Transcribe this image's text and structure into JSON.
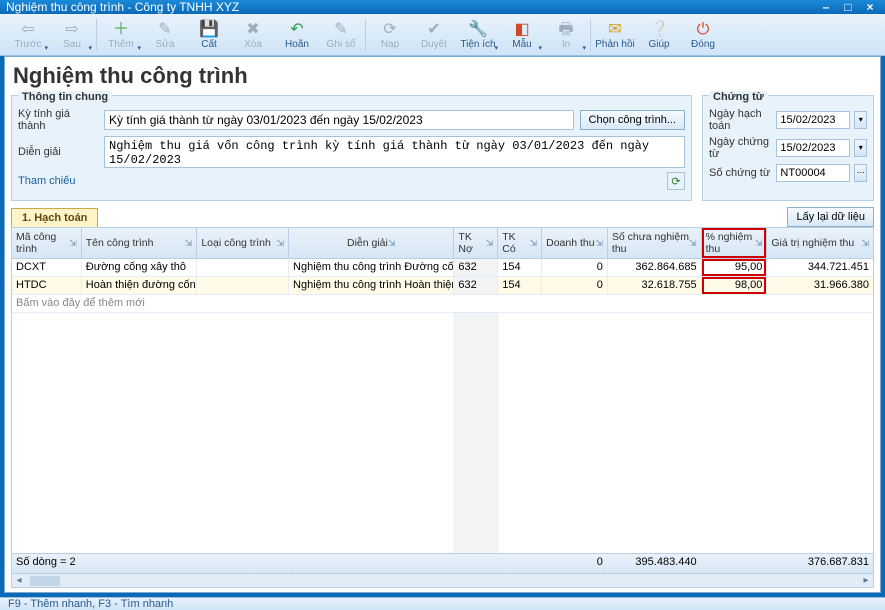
{
  "window": {
    "title": "Nghiệm thu công trình - Công ty TNHH XYZ"
  },
  "toolbar": {
    "truoc": "Trước",
    "sau": "Sau",
    "them": "Thêm",
    "sua": "Sửa",
    "cat": "Cất",
    "xoa": "Xóa",
    "hoan": "Hoãn",
    "ghiso": "Ghi sổ",
    "nap": "Nạp",
    "duyet": "Duyệt",
    "tienich": "Tiện ích",
    "mau": "Mẫu",
    "in": "In",
    "phanhoi": "Phản hồi",
    "giup": "Giúp",
    "dong": "Đóng"
  },
  "page": {
    "title": "Nghiệm thu công trình"
  },
  "general": {
    "legend": "Thông tin chung",
    "ky_label": "Kỳ tính giá thành",
    "ky_value": "Kỳ tính giá thành từ ngày 03/01/2023 đến ngày 15/02/2023",
    "choncongtrinh": "Chọn công trình...",
    "diengiai_label": "Diễn giải",
    "diengiai_value": "Nghiệm thu giá vốn công trình kỳ tính giá thành từ ngày 03/01/2023 đến ngày 15/02/2023",
    "thamchieu": "Tham chiếu"
  },
  "voucher": {
    "legend": "Chứng từ",
    "ngayhachtoan_label": "Ngày hạch toán",
    "ngayhachtoan": "15/02/2023",
    "ngaychungtu_label": "Ngày chứng từ",
    "ngaychungtu": "15/02/2023",
    "sochungtu_label": "Số chứng từ",
    "sochungtu": "NT00004"
  },
  "tab": {
    "hachtoan": "1. Hạch toán",
    "laylaidulieu": "Lấy lại dữ liệu"
  },
  "grid": {
    "headers": {
      "ma": "Mã công trình",
      "ten": "Tên công trình",
      "loai": "Loại công trình",
      "diengiai": "Diễn giải",
      "tkno": "TK Nợ",
      "tkco": "TK Có",
      "doanhthu": "Doanh thu",
      "sochua": "Số chưa nghiệm thu",
      "phantram": "% nghiệm thu",
      "giatri": "Giá trị nghiệm thu"
    },
    "rows": [
      {
        "ma": "DCXT",
        "ten": "Đường cống xây thô",
        "loai": "",
        "dg": "Nghiệm thu công trình Đường cống xây t",
        "tkno": "632",
        "tkco": "154",
        "dt": "0",
        "scnt": "362.864.685",
        "pnt": "95,00",
        "gtnt": "344.721.451"
      },
      {
        "ma": "HTDC",
        "ten": "Hoàn thiện đường cống",
        "loai": "",
        "dg": "Nghiệm thu công trình Hoàn thiện đườn",
        "tkno": "632",
        "tkco": "154",
        "dt": "0",
        "scnt": "32.618.755",
        "pnt": "98,00",
        "gtnt": "31.966.380"
      }
    ],
    "addrow": "Bấm vào đây để thêm mới",
    "footer": {
      "sodong": "Số dòng = 2",
      "dt_sum": "0",
      "scnt_sum": "395.483.440",
      "gtnt_sum": "376.687.831"
    }
  },
  "statusbar": {
    "text": "F9 - Thêm nhanh, F3 - Tìm nhanh"
  }
}
